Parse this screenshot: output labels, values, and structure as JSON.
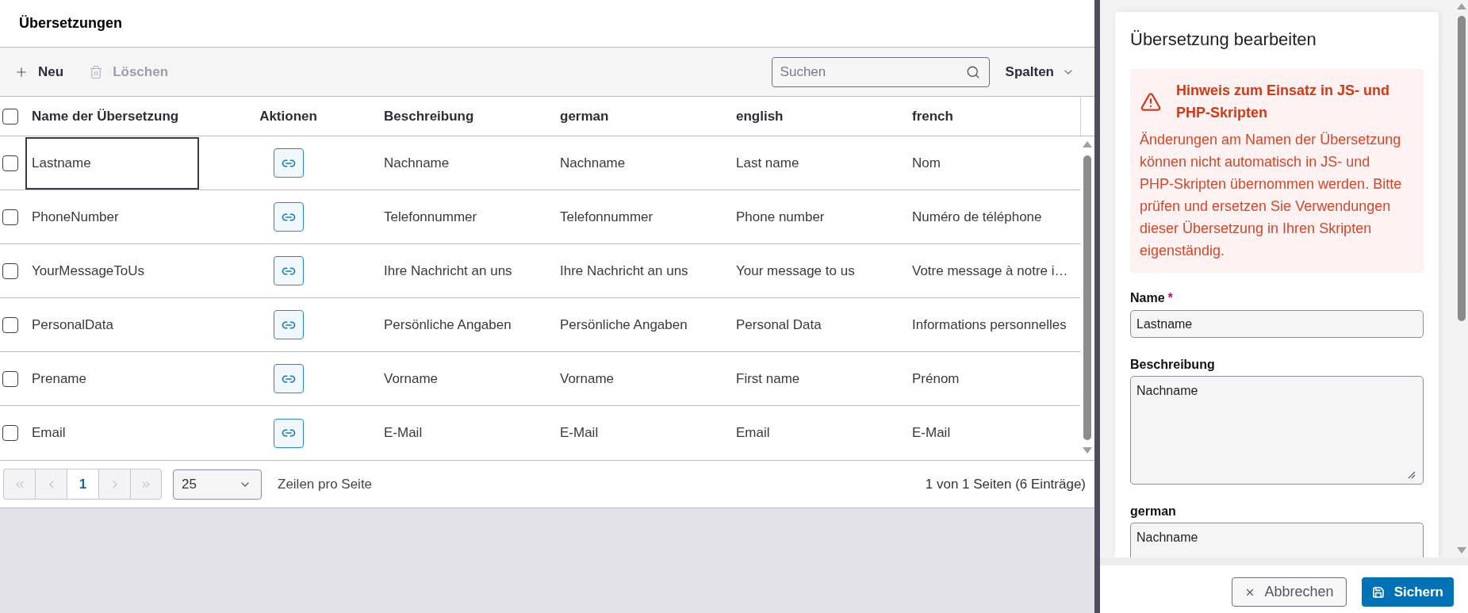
{
  "page": {
    "title": "Übersetzungen"
  },
  "toolbar": {
    "buttons": [
      {
        "kind": "add",
        "label": "Neu",
        "disabled": false
      },
      {
        "kind": "delete",
        "label": "Löschen",
        "disabled": true
      }
    ],
    "search": {
      "placeholder": "Suchen"
    },
    "columns_button": {
      "label": "Spalten"
    }
  },
  "table": {
    "select_all": {
      "checked": false
    },
    "columns": [
      "Name der Übersetzung",
      "Aktionen",
      "Beschreibung",
      "german",
      "english",
      "french"
    ],
    "rows": [
      {
        "checked": false,
        "focused": true,
        "name": "Lastname",
        "description": "Nachname",
        "german": "Nachname",
        "english": "Last name",
        "french": "Nom"
      },
      {
        "checked": false,
        "focused": false,
        "name": "PhoneNumber",
        "description": "Telefonnummer",
        "german": "Telefonnummer",
        "english": "Phone number",
        "french": "Numéro de téléphone"
      },
      {
        "checked": false,
        "focused": false,
        "name": "YourMessageToUs",
        "description": "Ihre Nachricht an uns",
        "german": "Ihre Nachricht an uns",
        "english": "Your message to us",
        "french": "Votre message à notre i…"
      },
      {
        "checked": false,
        "focused": false,
        "name": "PersonalData",
        "description": "Persönliche Angaben",
        "german": "Persönliche Angaben",
        "english": "Personal Data",
        "french": "Informations personnelles"
      },
      {
        "checked": false,
        "focused": false,
        "name": "Prename",
        "description": "Vorname",
        "german": "Vorname",
        "english": "First name",
        "french": "Prénom"
      },
      {
        "checked": false,
        "focused": false,
        "name": "Email",
        "description": "E-Mail",
        "german": "E-Mail",
        "english": "Email",
        "french": "E-Mail"
      }
    ]
  },
  "pagination": {
    "pager": [
      {
        "kind": "first",
        "disabled": true
      },
      {
        "kind": "previous",
        "disabled": true
      },
      {
        "kind": "page",
        "label": "1",
        "selected": true
      },
      {
        "kind": "next",
        "disabled": true
      },
      {
        "kind": "last",
        "disabled": true
      }
    ],
    "page_size": "25",
    "page_size_label": "Zeilen pro Seite",
    "summary": "1 von 1 Seiten (6 Einträge)"
  },
  "editor": {
    "title": "Übersetzung bearbeiten",
    "alert": {
      "title": "Hinweis zum Einsatz in JS- und PHP-Skripten",
      "text": "Änderungen am Namen der Übersetzung können nicht automatisch in JS- und PHP-Skripten übernommen werden. Bitte prüfen und ersetzen Sie Verwendungen dieser Übersetzung in Ihren Skripten eigenständig."
    },
    "required_marker": "*",
    "fields": [
      {
        "kind": "input",
        "label": "Name",
        "required": true,
        "value": "Lastname"
      },
      {
        "kind": "textarea",
        "label": "Beschreibung",
        "required": false,
        "value": "Nachname"
      },
      {
        "kind": "textarea",
        "label": "german",
        "required": false,
        "value": "Nachname"
      }
    ],
    "buttons": [
      {
        "kind": "cancel",
        "label": "Abbrechen"
      },
      {
        "kind": "save",
        "label": "Sichern"
      }
    ]
  }
}
